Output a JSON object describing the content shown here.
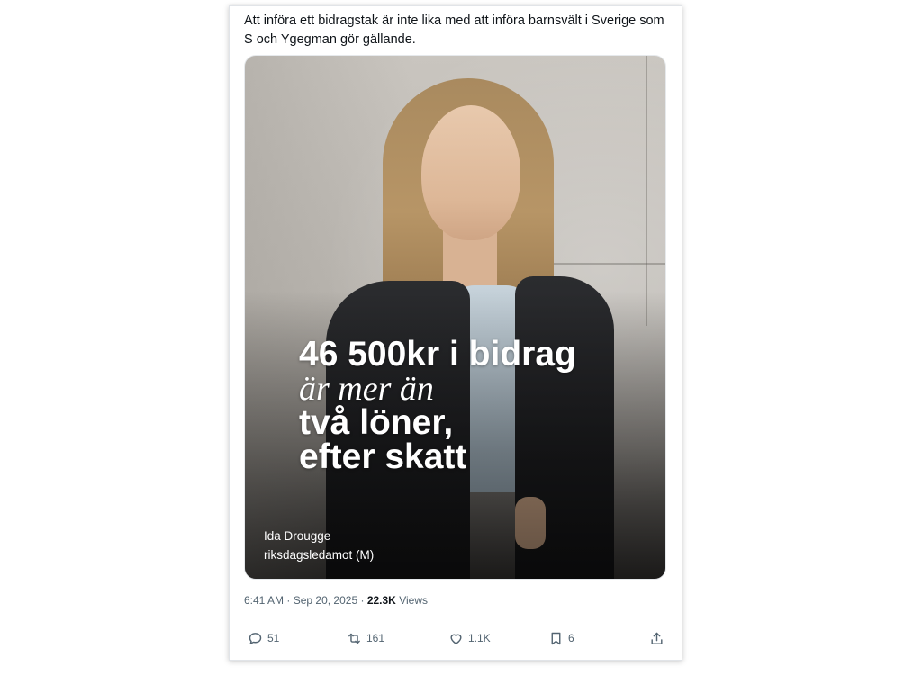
{
  "tweet": {
    "text": "Att införa ett bidragstak är inte lika med att införa barnsvält i Sverige som S och Ygegman gör gällande."
  },
  "image": {
    "headline_line1": "46 500kr i bidrag",
    "headline_line2": "är mer än",
    "headline_line3": "två löner,",
    "headline_line4": "efter skatt",
    "caption_name": "Ida Drougge",
    "caption_title": "riksdagsledamot (M)"
  },
  "meta": {
    "time": "6:41 AM",
    "separator": "·",
    "date": "Sep 20, 2025",
    "views_count": "22.3K",
    "views_label": "Views"
  },
  "actions": {
    "reply_count": "51",
    "repost_count": "161",
    "like_count": "1.1K",
    "bookmark_count": "6"
  },
  "icons": {
    "reply": "reply-icon",
    "repost": "repost-icon",
    "like": "heart-icon",
    "bookmark": "bookmark-icon",
    "share": "share-icon"
  },
  "colors": {
    "text": "#0f1419",
    "muted": "#536471",
    "background": "#ffffff"
  }
}
